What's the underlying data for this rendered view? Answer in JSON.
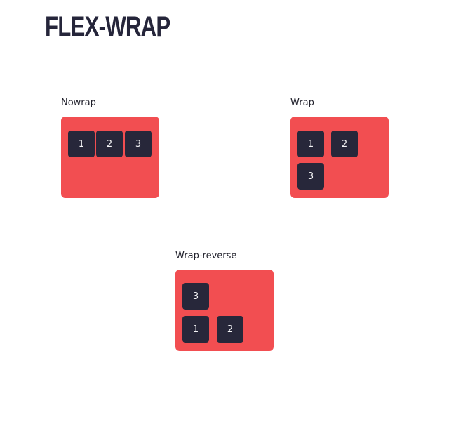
{
  "title": "FLEX-WRAP",
  "colors": {
    "container": "#f24e51",
    "item": "#27273a",
    "item_text": "#f4f4f6",
    "title": "#25253a"
  },
  "demos": [
    {
      "label": "Nowrap",
      "items": [
        "1",
        "2",
        "3"
      ]
    },
    {
      "label": "Wrap",
      "items": [
        "1",
        "2",
        "3"
      ]
    },
    {
      "label": "Wrap-reverse",
      "items": [
        "3",
        "1",
        "2"
      ]
    }
  ]
}
